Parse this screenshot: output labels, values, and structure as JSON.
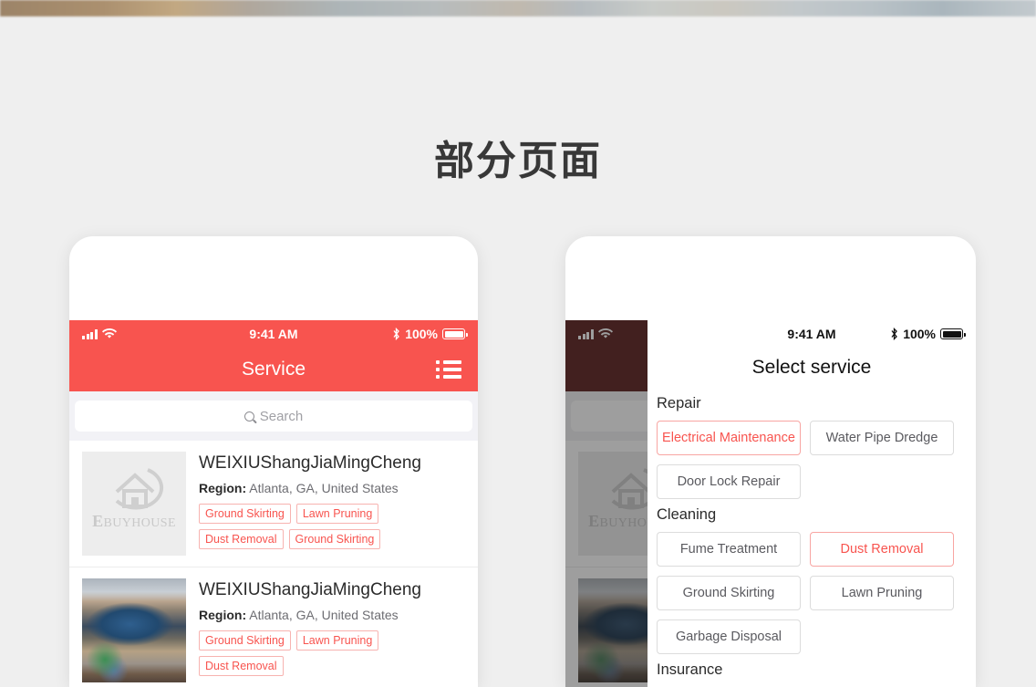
{
  "page": {
    "title": "部分页面",
    "background_color": "#efefef",
    "accent_color": "#f8544f"
  },
  "left_phone": {
    "status_bar": {
      "time": "9:41 AM",
      "battery_percent": "100%",
      "signal_icon": "cellular-bars-icon",
      "wifi_icon": "wifi-icon",
      "bluetooth_icon": "bluetooth-icon",
      "battery_icon": "battery-full-icon"
    },
    "navbar": {
      "title": "Service",
      "menu_icon": "list-menu-icon"
    },
    "search": {
      "placeholder": "Search",
      "icon": "search-icon",
      "value": ""
    },
    "items": [
      {
        "thumb_type": "ebuyhouse-logo-placeholder",
        "logo_text_small": "E",
        "logo_text": "BUYHOUSE",
        "name": "WEIXIUShangJiaMingCheng",
        "region_label": "Region:",
        "region_value": "Atlanta, GA, United States",
        "tags": [
          "Ground Skirting",
          "Lawn Pruning",
          "Dust Removal",
          "Ground Skirting"
        ]
      },
      {
        "thumb_type": "hardware-photo",
        "name": "WEIXIUShangJiaMingCheng",
        "region_label": "Region:",
        "region_value": "Atlanta, GA, United States",
        "tags": [
          "Ground Skirting",
          "Lawn Pruning",
          "Dust Removal"
        ]
      }
    ]
  },
  "right_phone": {
    "status_bar": {
      "time": "9:41 AM",
      "battery_percent": "100%"
    },
    "modal": {
      "title": "Select service",
      "categories": [
        {
          "name": "Repair",
          "options": [
            {
              "label": "Electrical Maintenance",
              "selected": true
            },
            {
              "label": "Water Pipe Dredge",
              "selected": false
            },
            {
              "label": "Door Lock Repair",
              "selected": false
            }
          ]
        },
        {
          "name": "Cleaning",
          "options": [
            {
              "label": "Fume Treatment",
              "selected": false
            },
            {
              "label": "Dust Removal",
              "selected": true
            },
            {
              "label": "Ground Skirting",
              "selected": false
            },
            {
              "label": "Lawn Pruning",
              "selected": false
            },
            {
              "label": "Garbage Disposal",
              "selected": false
            }
          ]
        },
        {
          "name": "Insurance",
          "options": []
        }
      ]
    }
  }
}
